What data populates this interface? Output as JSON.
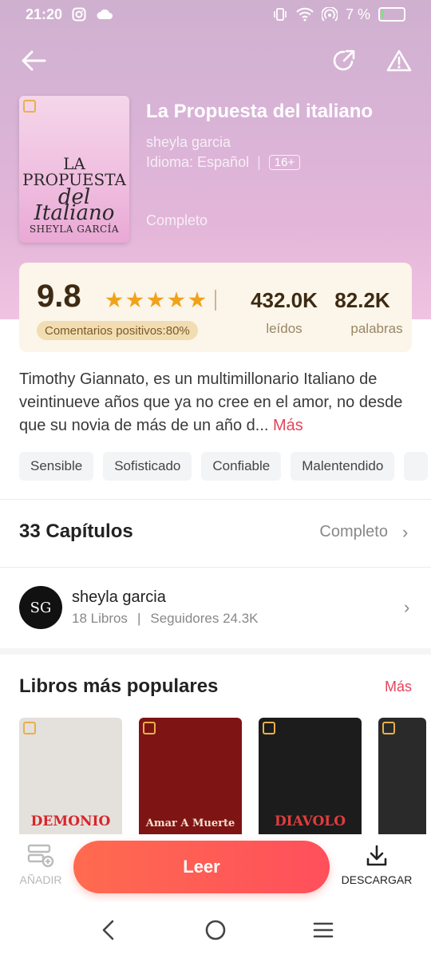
{
  "status_bar": {
    "time": "21:20",
    "battery_percent": "7 %",
    "battery_level": 0.07
  },
  "book": {
    "title": "La Propuesta del italiano",
    "author": "sheyla garcia",
    "language": "Idioma: Español",
    "age_rating": "16+",
    "status": "Completo",
    "cover": {
      "title_line1": "LA PROPUESTA",
      "title_line2": "del",
      "title_line3": "Italiano",
      "author": "SHEYLA GARCÍA"
    }
  },
  "rating": {
    "score": "9.8",
    "stars": 5,
    "positive": "Comentarios positivos:80%",
    "reads_value": "432.0K",
    "reads_label": "leídos",
    "words_value": "82.2K",
    "words_label": "palabras"
  },
  "synopsis": {
    "text": "Timothy Giannato, es un multimillonario Italiano de veintinueve años que ya no cree en el amor, no desde que su novia de más de un año d...",
    "more_label": "Más"
  },
  "tags": [
    "Sensible",
    "Sofisticado",
    "Confiable",
    "Malentendido"
  ],
  "chapters": {
    "label": "33 Capítulos",
    "status": "Completo"
  },
  "author_card": {
    "avatar_text": "SG",
    "name": "sheyla garcia",
    "books": "18 Libros",
    "followers": "Seguidores 24.3K"
  },
  "popular": {
    "title": "Libros más populares",
    "more_label": "Más",
    "books": [
      {
        "label": "DEMONIO",
        "color": "#e4e0dc",
        "label_color": "#d7262b"
      },
      {
        "label": "Amar A Muerte",
        "color": "#7e1414",
        "label_color": "#f3e0d0"
      },
      {
        "label": "DIAVOLO",
        "color": "#1c1c1c",
        "label_color": "#e23c3c"
      },
      {
        "label": "",
        "color": "#2a2a2a",
        "label_color": "#d7262b"
      }
    ]
  },
  "actions": {
    "add_label": "AÑADIR",
    "read_label": "Leer",
    "download_label": "DESCARGAR"
  },
  "colors": {
    "accent": "#e3455a",
    "star": "#f0a21a",
    "read_button": "#ff5a55"
  }
}
